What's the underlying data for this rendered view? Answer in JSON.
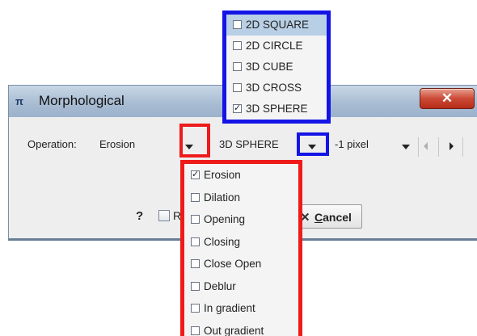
{
  "window": {
    "title": "Morphological",
    "app_icon": "pi-app-icon",
    "app_icon_glyph": "π",
    "close_glyph": "✕"
  },
  "settings": {
    "operation_label": "Operation:",
    "operation_value": "Erosion",
    "shape_value": "3D SPHERE",
    "size_value": "-1 pixel"
  },
  "footer": {
    "help_glyph": "?",
    "apply_label_partial": "R",
    "cancel_glyph": "✕",
    "cancel_label": "Cancel"
  },
  "shape_menu": {
    "items": [
      {
        "label": "2D SQUARE",
        "checked": false,
        "highlighted": true
      },
      {
        "label": "2D CIRCLE",
        "checked": false
      },
      {
        "label": "3D CUBE",
        "checked": false
      },
      {
        "label": "3D CROSS",
        "checked": false
      },
      {
        "label": "3D SPHERE",
        "checked": true
      }
    ]
  },
  "operation_menu": {
    "items": [
      {
        "label": "Erosion",
        "checked": true
      },
      {
        "label": "Dilation",
        "checked": false
      },
      {
        "label": "Opening",
        "checked": false
      },
      {
        "label": "Closing",
        "checked": false
      },
      {
        "label": "Close Open",
        "checked": false
      },
      {
        "label": "Deblur",
        "checked": false
      },
      {
        "label": "In gradient",
        "checked": false
      },
      {
        "label": "Out gradient",
        "checked": false
      }
    ]
  },
  "colors": {
    "highlight_red": "#ee1b1b",
    "highlight_blue": "#1414e6",
    "menu_selection": "#b8cfe5"
  }
}
